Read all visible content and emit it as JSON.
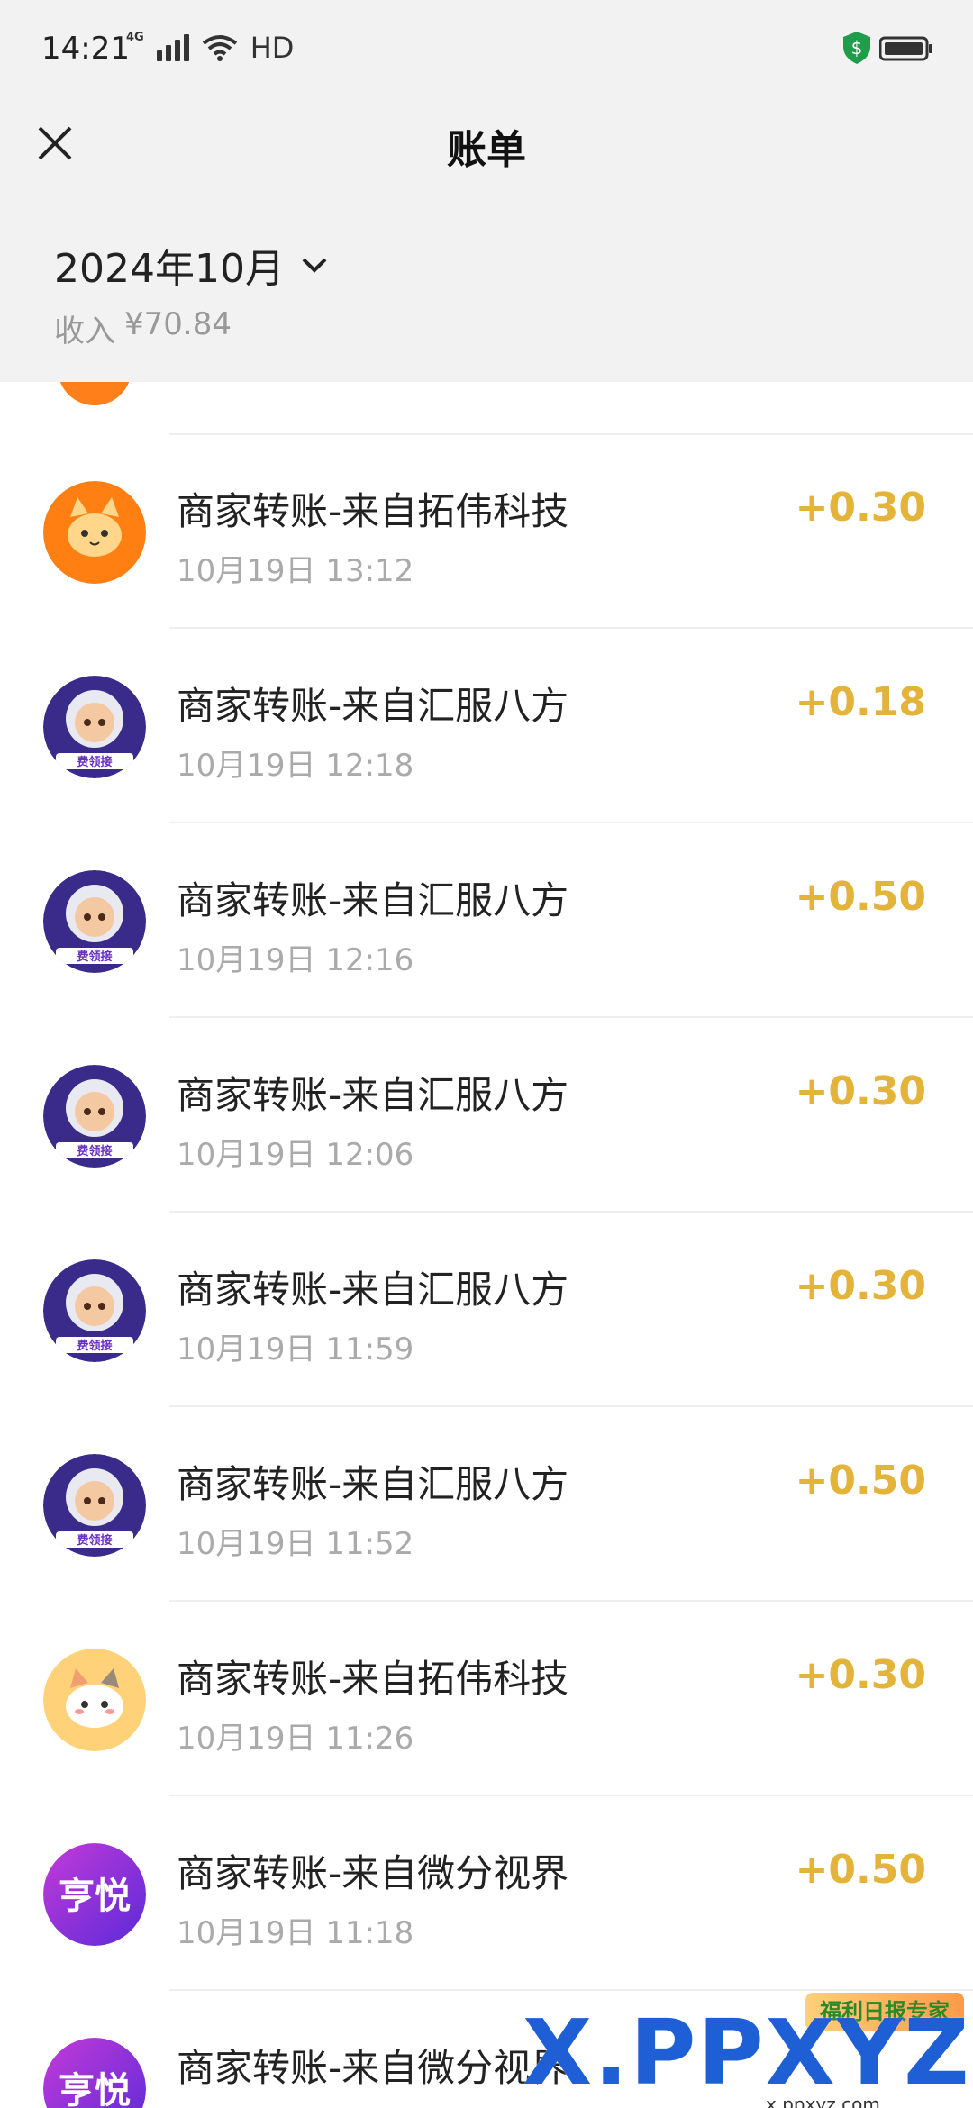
{
  "status_bar": {
    "time": "14:21",
    "network": "4G",
    "hd": "HD"
  },
  "header": {
    "title": "账单"
  },
  "summary": {
    "month": "2024年10月",
    "income_label": "收入",
    "income_value": "¥70.84"
  },
  "rows": [
    {
      "title": "商家转账-来自拓伟科技",
      "time": "10月19日 13:12",
      "amount": "+0.30",
      "avatar": "orange-cat-avatar"
    },
    {
      "title": "商家转账-来自汇服八方",
      "time": "10月19日 12:18",
      "amount": "+0.18",
      "avatar": "astronaut-avatar"
    },
    {
      "title": "商家转账-来自汇服八方",
      "time": "10月19日 12:16",
      "amount": "+0.50",
      "avatar": "astronaut-avatar"
    },
    {
      "title": "商家转账-来自汇服八方",
      "time": "10月19日 12:06",
      "amount": "+0.30",
      "avatar": "astronaut-avatar"
    },
    {
      "title": "商家转账-来自汇服八方",
      "time": "10月19日 11:59",
      "amount": "+0.30",
      "avatar": "astronaut-avatar"
    },
    {
      "title": "商家转账-来自汇服八方",
      "time": "10月19日 11:52",
      "amount": "+0.50",
      "avatar": "astronaut-avatar"
    },
    {
      "title": "商家转账-来自拓伟科技",
      "time": "10月19日 11:26",
      "amount": "+0.30",
      "avatar": "yellow-cat-avatar"
    },
    {
      "title": "商家转账-来自微分视界",
      "time": "10月19日 11:18",
      "amount": "+0.50",
      "avatar": "hengyue-avatar"
    },
    {
      "title": "商家转账-来自微分视界",
      "time": "",
      "amount": "",
      "avatar": "hengyue-avatar"
    }
  ],
  "avatar_text": {
    "astronaut": "费领接",
    "hengyue": "亨悦"
  },
  "watermark": {
    "text": "X.PPXYZ.com",
    "badge": "福利日报专家",
    "small": "x.ppxyz.com"
  },
  "colors": {
    "amount": "#e3b33a",
    "header_bg": "#f2f2f2"
  }
}
